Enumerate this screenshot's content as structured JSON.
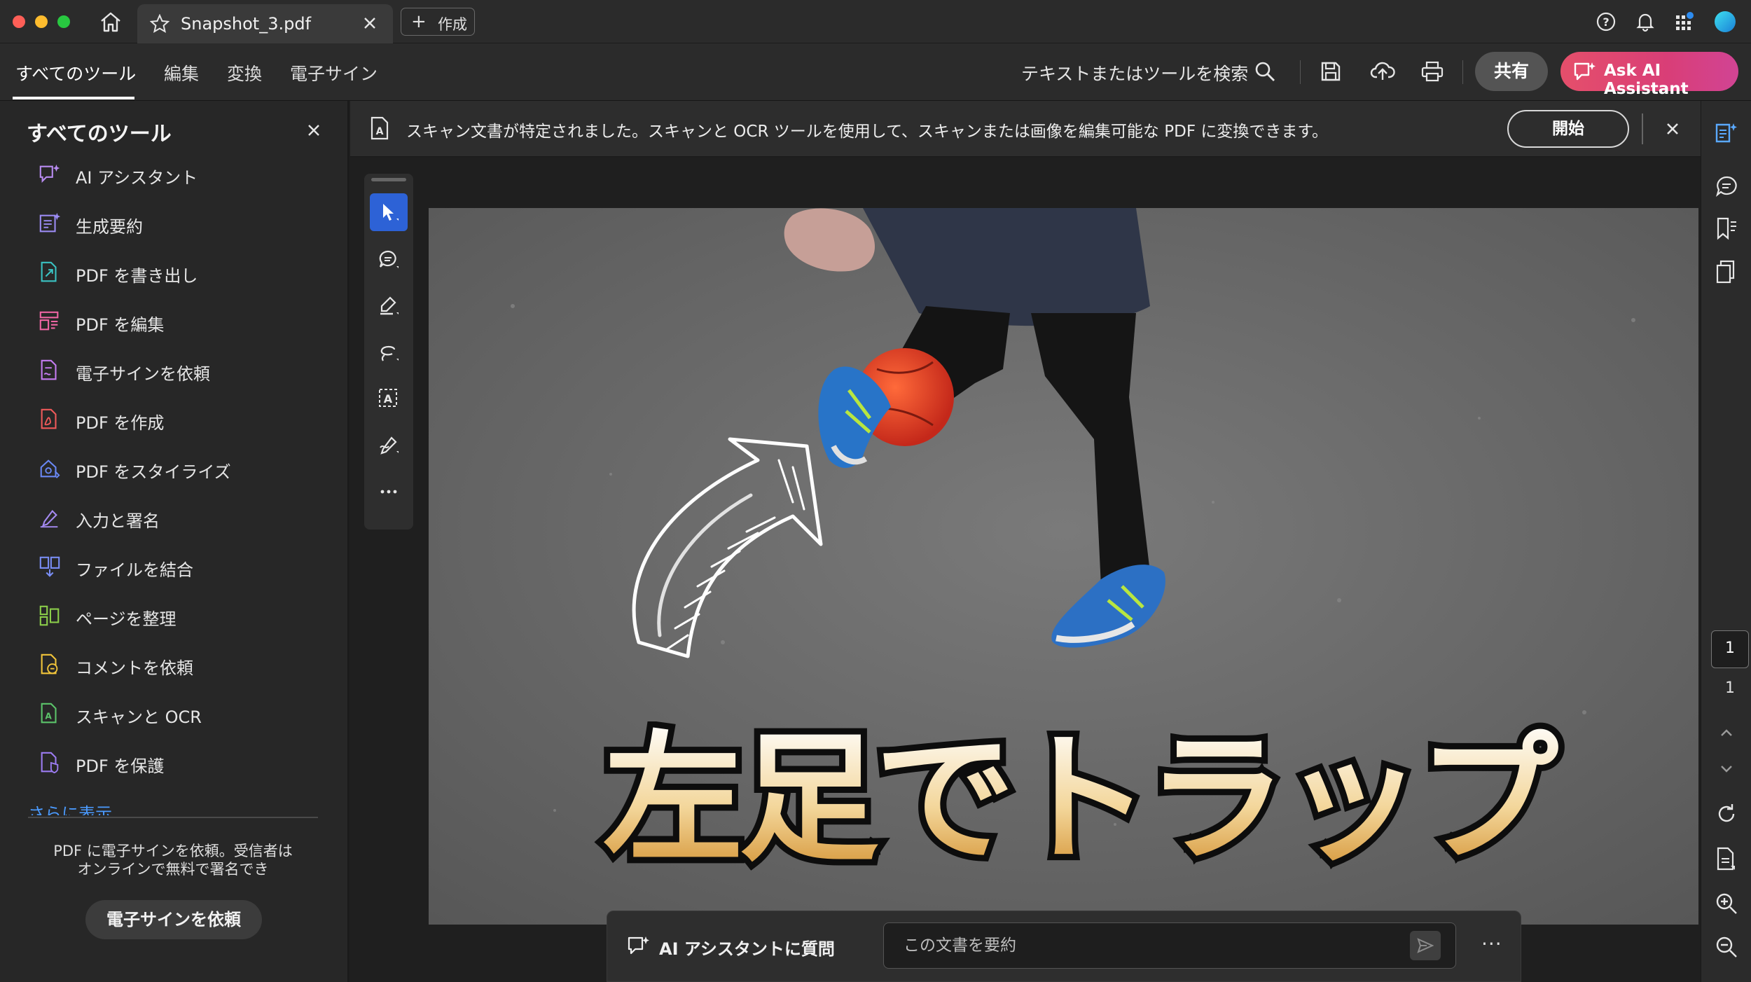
{
  "window": {
    "tab_title": "Snapshot_3.pdf",
    "create_label": "作成"
  },
  "menu": {
    "tabs": [
      "すべてのツール",
      "編集",
      "変換",
      "電子サイン"
    ],
    "search_label": "テキストまたはツールを検索",
    "share_label": "共有",
    "ai_button_label": "Ask AI Assistant"
  },
  "left_panel": {
    "title": "すべてのツール",
    "tools": [
      {
        "label": "AI アシスタント",
        "icon": "ai-assistant-icon",
        "color": "#b98cf2"
      },
      {
        "label": "生成要約",
        "icon": "summary-icon",
        "color": "#9c8cf5"
      },
      {
        "label": "PDF を書き出し",
        "icon": "export-pdf-icon",
        "color": "#3ac2c2"
      },
      {
        "label": "PDF を編集",
        "icon": "edit-pdf-icon",
        "color": "#f066a4"
      },
      {
        "label": "電子サインを依頼",
        "icon": "request-esign-icon",
        "color": "#c57cf2"
      },
      {
        "label": "PDF を作成",
        "icon": "create-pdf-icon",
        "color": "#f05a5a"
      },
      {
        "label": "PDF をスタイライズ",
        "icon": "stylize-pdf-icon",
        "color": "#6a88f5"
      },
      {
        "label": "入力と署名",
        "icon": "fill-sign-icon",
        "color": "#a58af2"
      },
      {
        "label": "ファイルを結合",
        "icon": "combine-files-icon",
        "color": "#7a8ef5"
      },
      {
        "label": "ページを整理",
        "icon": "organize-pages-icon",
        "color": "#8ccf4a"
      },
      {
        "label": "コメントを依頼",
        "icon": "request-comments-icon",
        "color": "#f2c53a"
      },
      {
        "label": "スキャンと OCR",
        "icon": "scan-ocr-icon",
        "color": "#5cc46a"
      },
      {
        "label": "PDF を保護",
        "icon": "protect-pdf-icon",
        "color": "#9c7cf2"
      }
    ],
    "more_label": "さらに表示",
    "promo_text": "PDF に電子サインを依頼。受信者は\nオンラインで無料で署名でき",
    "promo_button": "電子サインを依頼"
  },
  "notice": {
    "message": "スキャン文書が特定されました。スキャンと OCR ツールを使用して、スキャンまたは画像を編集可能な PDF に変換できます。",
    "start_label": "開始"
  },
  "document": {
    "caption": "左足でトラップ"
  },
  "ai_bar": {
    "label": "AI アシスタントに質問",
    "input_value": "この文書を要約",
    "more": "···"
  },
  "right_rail": {
    "current_page": "1",
    "total_pages": "1"
  },
  "colors": {
    "accent_blue": "#2d62d6",
    "ai_gradient_start": "#e54f6b",
    "ai_gradient_end": "#d14494",
    "link": "#4b9bff"
  }
}
